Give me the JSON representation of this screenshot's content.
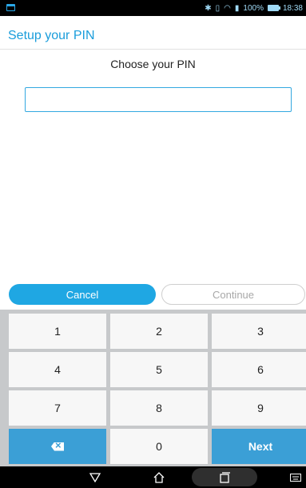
{
  "status_bar": {
    "time": "18:38",
    "battery": "100%"
  },
  "header": {
    "title": "Setup your PIN"
  },
  "main": {
    "prompt": "Choose your PIN",
    "pin_value": ""
  },
  "buttons": {
    "cancel": "Cancel",
    "continue": "Continue"
  },
  "keypad": {
    "k1": "1",
    "k2": "2",
    "k3": "3",
    "k4": "4",
    "k5": "5",
    "k6": "6",
    "k7": "7",
    "k8": "8",
    "k9": "9",
    "k0": "0",
    "next": "Next"
  },
  "colors": {
    "accent": "#1fa7e3",
    "keypad_accent": "#3b9fd6",
    "title": "#1a9ddb"
  }
}
